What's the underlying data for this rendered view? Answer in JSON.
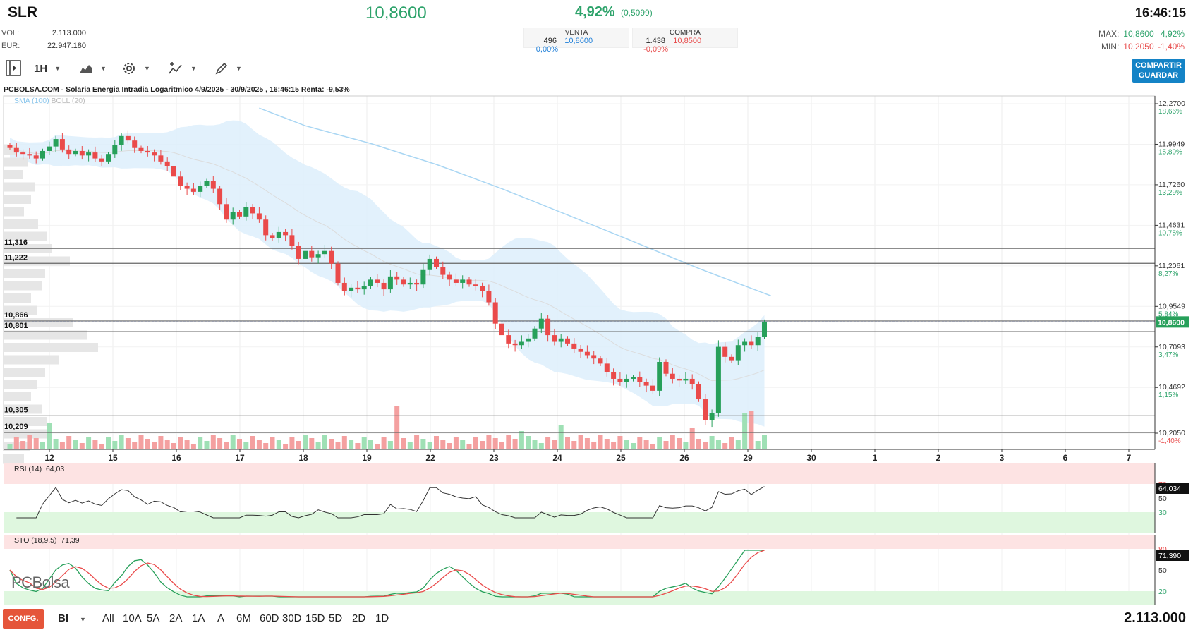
{
  "header": {
    "ticker": "SLR",
    "price": "10,8600",
    "change_pct": "4,92%",
    "change_abs": "(0,5099)",
    "time": "16:46:15",
    "vol_label": "VOL:",
    "vol_value": "2.113.000",
    "eur_label": "EUR:",
    "eur_value": "22.947.180"
  },
  "quotes": {
    "venta": {
      "label": "VENTA",
      "qty": "496",
      "price": "10,8600",
      "pct": "0,00%"
    },
    "compra": {
      "label": "COMPRA",
      "qty": "1.438",
      "price": "10,8500",
      "pct": "-0,09%"
    }
  },
  "maxmin": {
    "max_label": "MAX:",
    "max_value": "10,8600",
    "max_pct": "4,92%",
    "min_label": "MIN:",
    "min_value": "10,2050",
    "min_pct": "-1,40%"
  },
  "toolbar": {
    "interval": "1H",
    "share_label_1": "COMPARTIR",
    "share_label_2": "GUARDAR"
  },
  "chart_header": "PCBOLSA.COM - Solaria Energia Intradia Logaritmico 4/9/2025 - 30/9/2025 , 16:46:15 Renta: -9,53%",
  "legend": {
    "sma": "SMA (100)",
    "boll": "BOLL (20)"
  },
  "rsi_label": "RSI (14)",
  "rsi_value": "64,03",
  "rsi_tag": "64,034",
  "sto_label": "STO (18,9,5)",
  "sto_value": "71,39",
  "sto_tag": "71,390",
  "logo": "PCBolsa",
  "bottom": {
    "config": "CONFG.",
    "mode": "BI",
    "ranges": [
      "All",
      "10A",
      "5A",
      "2A",
      "1A",
      "A",
      "6M",
      "60D",
      "30D",
      "15D",
      "5D",
      "2D",
      "1D"
    ],
    "volume": "2.113.000"
  },
  "chart_data": {
    "type": "candlestick",
    "scale": "log",
    "x_ticks": [
      "12",
      "15",
      "16",
      "17",
      "18",
      "19",
      "22",
      "23",
      "24",
      "25",
      "26",
      "29",
      "30",
      "1",
      "2",
      "3",
      "6",
      "7"
    ],
    "y_ticks": [
      {
        "price": "12,2700",
        "pct": "18,66%"
      },
      {
        "price": "11,9949",
        "pct": "15,89%"
      },
      {
        "price": "11,7260",
        "pct": "13,29%"
      },
      {
        "price": "11,4631",
        "pct": "10,75%"
      },
      {
        "price": "11,2061",
        "pct": "8,27%"
      },
      {
        "price": "10,9549",
        "pct": "5,84%"
      },
      {
        "price": "10,7093",
        "pct": "3,47%"
      },
      {
        "price": "10,4692",
        "pct": "1,15%"
      },
      {
        "price": "10,2050",
        "pct": "-1,40%"
      }
    ],
    "last_price_tag": "10,8600",
    "levels": [
      "11,316",
      "11,222",
      "10,866",
      "10,801",
      "10,305",
      "10,209"
    ],
    "level_values": [
      11.316,
      11.222,
      10.866,
      10.801,
      10.305,
      10.209
    ],
    "prev_close": 11.99,
    "rsi_ticks": [
      "70",
      "50",
      "30"
    ],
    "sto_ticks": [
      "80",
      "50",
      "20"
    ],
    "close": [
      11.97,
      11.94,
      11.93,
      11.92,
      11.9,
      11.95,
      11.98,
      12.03,
      11.96,
      11.93,
      11.95,
      11.92,
      11.94,
      11.9,
      11.88,
      11.93,
      11.99,
      12.05,
      12.02,
      11.97,
      11.95,
      11.94,
      11.92,
      11.88,
      11.85,
      11.78,
      11.72,
      11.7,
      11.68,
      11.72,
      11.75,
      11.7,
      11.6,
      11.5,
      11.55,
      11.52,
      11.58,
      11.54,
      11.5,
      11.4,
      11.38,
      11.42,
      11.4,
      11.33,
      11.25,
      11.3,
      11.26,
      11.28,
      11.3,
      11.22,
      11.1,
      11.05,
      11.07,
      11.06,
      11.08,
      11.12,
      11.1,
      11.06,
      11.14,
      11.12,
      11.09,
      11.1,
      11.09,
      11.18,
      11.25,
      11.2,
      11.15,
      11.12,
      11.1,
      11.12,
      11.09,
      11.08,
      11.05,
      10.98,
      10.85,
      10.78,
      10.73,
      10.72,
      10.74,
      10.76,
      10.82,
      10.88,
      10.78,
      10.74,
      10.76,
      10.73,
      10.7,
      10.68,
      10.66,
      10.64,
      10.61,
      10.56,
      10.52,
      10.5,
      10.52,
      10.53,
      10.5,
      10.48,
      10.45,
      10.62,
      10.55,
      10.52,
      10.51,
      10.52,
      10.49,
      10.4,
      10.28,
      10.32,
      10.71,
      10.65,
      10.63,
      10.72,
      10.74,
      10.72,
      10.77,
      10.86
    ]
  }
}
